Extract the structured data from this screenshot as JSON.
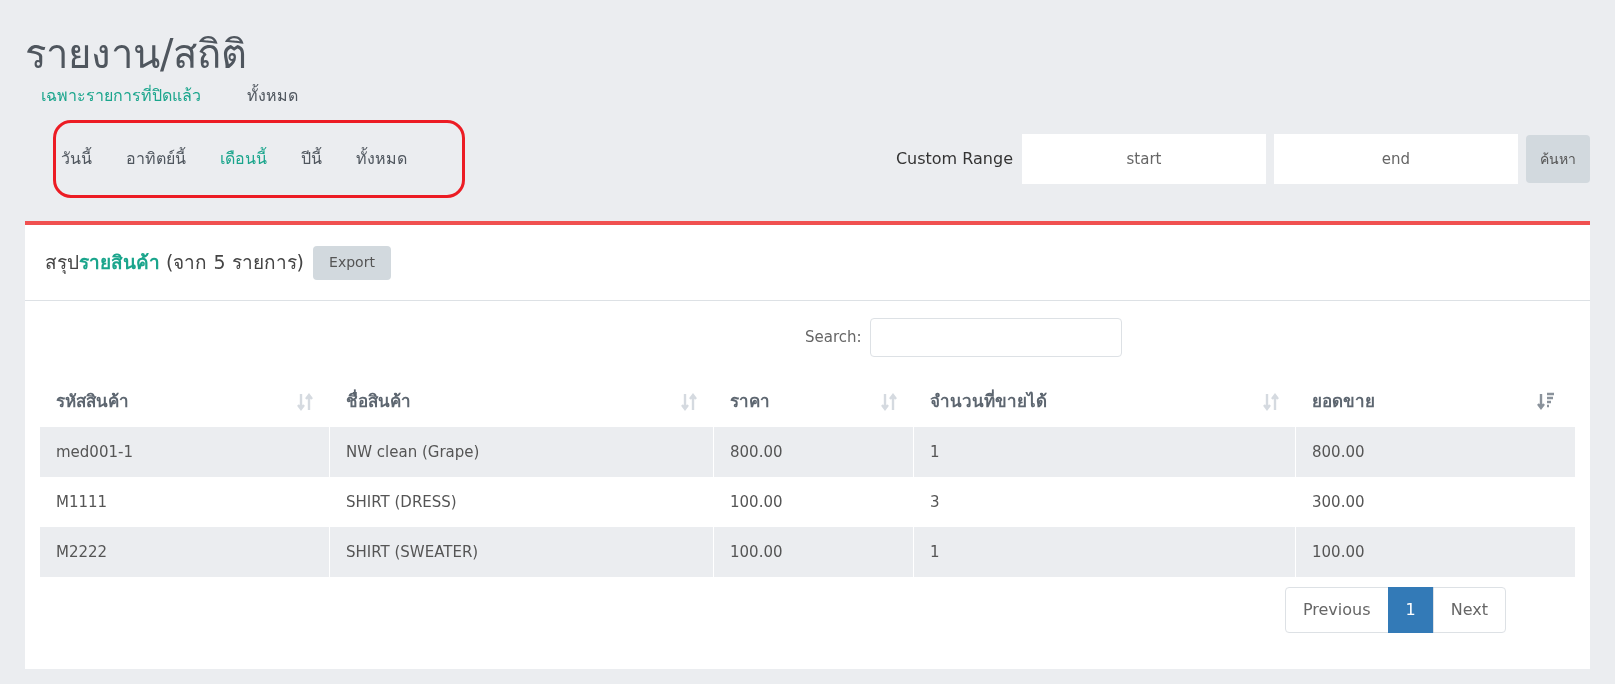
{
  "title": "รายงาน/สถิติ",
  "filter_tabs": [
    {
      "label": "เฉพาะรายการที่ปิดแล้ว",
      "selected": true
    },
    {
      "label": "ทั้งหมด",
      "selected": false
    }
  ],
  "period_tabs": [
    {
      "label": "วันนี้",
      "selected": false
    },
    {
      "label": "อาทิตย์นี้",
      "selected": false
    },
    {
      "label": "เดือนนี้",
      "selected": true
    },
    {
      "label": "ปีนี้",
      "selected": false
    },
    {
      "label": "ทั้งหมด",
      "selected": false
    }
  ],
  "custom_range": {
    "label": "Custom Range",
    "start_placeholder": "start",
    "end_placeholder": "end",
    "button": "ค้นหา"
  },
  "panel": {
    "heading": "สรุป**รายสินค้า** (จาก 5 รายการ)",
    "export_button": "Export"
  },
  "search": {
    "label": "Search:"
  },
  "table": {
    "columns": [
      {
        "label": "รหัสสินค้า",
        "sorted": false
      },
      {
        "label": "ชื่อสินค้า",
        "sorted": false
      },
      {
        "label": "ราคา",
        "sorted": false
      },
      {
        "label": "จำนวนที่ขายได้",
        "sorted": false
      },
      {
        "label": "ยอดขาย",
        "sorted": true
      }
    ],
    "rows": [
      [
        "med001-1",
        "NW clean (Grape)",
        "800.00",
        "1",
        "800.00"
      ],
      [
        "M1111",
        "SHIRT (DRESS)",
        "100.00",
        "3",
        "300.00"
      ],
      [
        "M2222",
        "SHIRT (SWEATER)",
        "100.00",
        "1",
        "100.00"
      ]
    ]
  },
  "pagination": [
    {
      "label": "Previous",
      "selected": false
    },
    {
      "label": "1",
      "selected": true
    },
    {
      "label": "Next",
      "selected": false
    }
  ]
}
